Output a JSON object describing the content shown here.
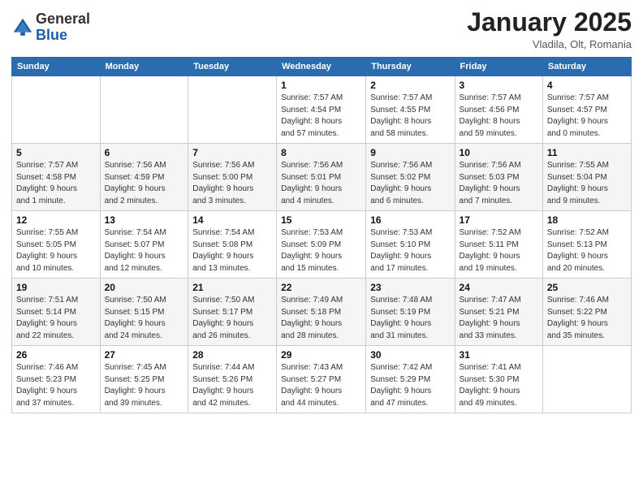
{
  "header": {
    "logo_general": "General",
    "logo_blue": "Blue",
    "month_title": "January 2025",
    "location": "Vladila, Olt, Romania"
  },
  "calendar": {
    "days_of_week": [
      "Sunday",
      "Monday",
      "Tuesday",
      "Wednesday",
      "Thursday",
      "Friday",
      "Saturday"
    ],
    "weeks": [
      [
        {
          "day": "",
          "info": ""
        },
        {
          "day": "",
          "info": ""
        },
        {
          "day": "",
          "info": ""
        },
        {
          "day": "1",
          "info": "Sunrise: 7:57 AM\nSunset: 4:54 PM\nDaylight: 8 hours\nand 57 minutes."
        },
        {
          "day": "2",
          "info": "Sunrise: 7:57 AM\nSunset: 4:55 PM\nDaylight: 8 hours\nand 58 minutes."
        },
        {
          "day": "3",
          "info": "Sunrise: 7:57 AM\nSunset: 4:56 PM\nDaylight: 8 hours\nand 59 minutes."
        },
        {
          "day": "4",
          "info": "Sunrise: 7:57 AM\nSunset: 4:57 PM\nDaylight: 9 hours\nand 0 minutes."
        }
      ],
      [
        {
          "day": "5",
          "info": "Sunrise: 7:57 AM\nSunset: 4:58 PM\nDaylight: 9 hours\nand 1 minute."
        },
        {
          "day": "6",
          "info": "Sunrise: 7:56 AM\nSunset: 4:59 PM\nDaylight: 9 hours\nand 2 minutes."
        },
        {
          "day": "7",
          "info": "Sunrise: 7:56 AM\nSunset: 5:00 PM\nDaylight: 9 hours\nand 3 minutes."
        },
        {
          "day": "8",
          "info": "Sunrise: 7:56 AM\nSunset: 5:01 PM\nDaylight: 9 hours\nand 4 minutes."
        },
        {
          "day": "9",
          "info": "Sunrise: 7:56 AM\nSunset: 5:02 PM\nDaylight: 9 hours\nand 6 minutes."
        },
        {
          "day": "10",
          "info": "Sunrise: 7:56 AM\nSunset: 5:03 PM\nDaylight: 9 hours\nand 7 minutes."
        },
        {
          "day": "11",
          "info": "Sunrise: 7:55 AM\nSunset: 5:04 PM\nDaylight: 9 hours\nand 9 minutes."
        }
      ],
      [
        {
          "day": "12",
          "info": "Sunrise: 7:55 AM\nSunset: 5:05 PM\nDaylight: 9 hours\nand 10 minutes."
        },
        {
          "day": "13",
          "info": "Sunrise: 7:54 AM\nSunset: 5:07 PM\nDaylight: 9 hours\nand 12 minutes."
        },
        {
          "day": "14",
          "info": "Sunrise: 7:54 AM\nSunset: 5:08 PM\nDaylight: 9 hours\nand 13 minutes."
        },
        {
          "day": "15",
          "info": "Sunrise: 7:53 AM\nSunset: 5:09 PM\nDaylight: 9 hours\nand 15 minutes."
        },
        {
          "day": "16",
          "info": "Sunrise: 7:53 AM\nSunset: 5:10 PM\nDaylight: 9 hours\nand 17 minutes."
        },
        {
          "day": "17",
          "info": "Sunrise: 7:52 AM\nSunset: 5:11 PM\nDaylight: 9 hours\nand 19 minutes."
        },
        {
          "day": "18",
          "info": "Sunrise: 7:52 AM\nSunset: 5:13 PM\nDaylight: 9 hours\nand 20 minutes."
        }
      ],
      [
        {
          "day": "19",
          "info": "Sunrise: 7:51 AM\nSunset: 5:14 PM\nDaylight: 9 hours\nand 22 minutes."
        },
        {
          "day": "20",
          "info": "Sunrise: 7:50 AM\nSunset: 5:15 PM\nDaylight: 9 hours\nand 24 minutes."
        },
        {
          "day": "21",
          "info": "Sunrise: 7:50 AM\nSunset: 5:17 PM\nDaylight: 9 hours\nand 26 minutes."
        },
        {
          "day": "22",
          "info": "Sunrise: 7:49 AM\nSunset: 5:18 PM\nDaylight: 9 hours\nand 28 minutes."
        },
        {
          "day": "23",
          "info": "Sunrise: 7:48 AM\nSunset: 5:19 PM\nDaylight: 9 hours\nand 31 minutes."
        },
        {
          "day": "24",
          "info": "Sunrise: 7:47 AM\nSunset: 5:21 PM\nDaylight: 9 hours\nand 33 minutes."
        },
        {
          "day": "25",
          "info": "Sunrise: 7:46 AM\nSunset: 5:22 PM\nDaylight: 9 hours\nand 35 minutes."
        }
      ],
      [
        {
          "day": "26",
          "info": "Sunrise: 7:46 AM\nSunset: 5:23 PM\nDaylight: 9 hours\nand 37 minutes."
        },
        {
          "day": "27",
          "info": "Sunrise: 7:45 AM\nSunset: 5:25 PM\nDaylight: 9 hours\nand 39 minutes."
        },
        {
          "day": "28",
          "info": "Sunrise: 7:44 AM\nSunset: 5:26 PM\nDaylight: 9 hours\nand 42 minutes."
        },
        {
          "day": "29",
          "info": "Sunrise: 7:43 AM\nSunset: 5:27 PM\nDaylight: 9 hours\nand 44 minutes."
        },
        {
          "day": "30",
          "info": "Sunrise: 7:42 AM\nSunset: 5:29 PM\nDaylight: 9 hours\nand 47 minutes."
        },
        {
          "day": "31",
          "info": "Sunrise: 7:41 AM\nSunset: 5:30 PM\nDaylight: 9 hours\nand 49 minutes."
        },
        {
          "day": "",
          "info": ""
        }
      ]
    ]
  }
}
